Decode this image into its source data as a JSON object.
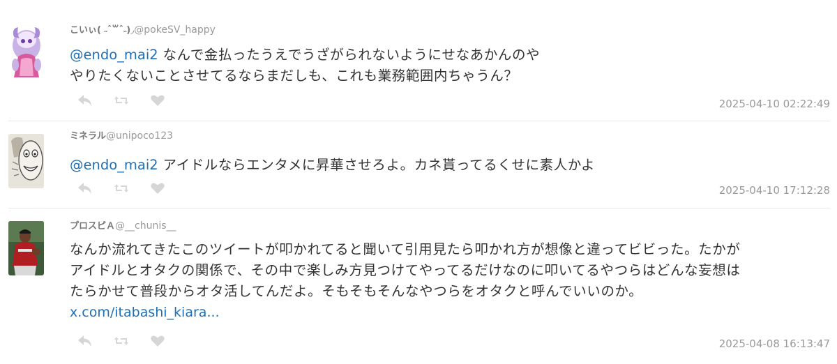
{
  "tweets": [
    {
      "name": "こいぃ( ˶ˆ꒳ˆ˵)◞",
      "handle": "@pokeSV_happy",
      "mention": "@endo_mai2",
      "line1": " なんで金払ったうえでうざがられないようにせなあかんのや",
      "line2": "やりたくないことさせてるならまだしも、これも業務範囲内ちゃうん？",
      "timestamp": "2025-04-10 02:22:49"
    },
    {
      "name": "ミネラル",
      "handle": "@unipoco123",
      "mention": "@endo_mai2",
      "line1": " アイドルならエンタメに昇華させろよ。カネ貰ってるくせに素人かよ",
      "timestamp": "2025-04-10 17:12:28"
    },
    {
      "name": "プロスピＡ",
      "handle": "@__chunis__",
      "line1": "なんか流れてきたこのツイートが叩かれてると聞いて引用見たら叩かれ方が想像と違ってビビった。たかが",
      "line2": "アイドルとオタクの関係で、その中で楽しみ方見つけてやってるだけなのに叩いてるやつらはどんな妄想は",
      "line3": "たらかせて普段からオタ活してんだよ。そもそもそんなやつらをオタクと呼んでいいのか。",
      "link": "x.com/itabashi_kiara...",
      "timestamp": "2025-04-08 16:13:47"
    }
  ],
  "icons": {
    "reply": "reply-arrow-icon",
    "retweet": "retweet-icon",
    "like": "heart-icon"
  },
  "colors": {
    "link": "#1d6fb8",
    "muted": "#999999",
    "icon": "#d6d6d6",
    "text": "#333333"
  }
}
